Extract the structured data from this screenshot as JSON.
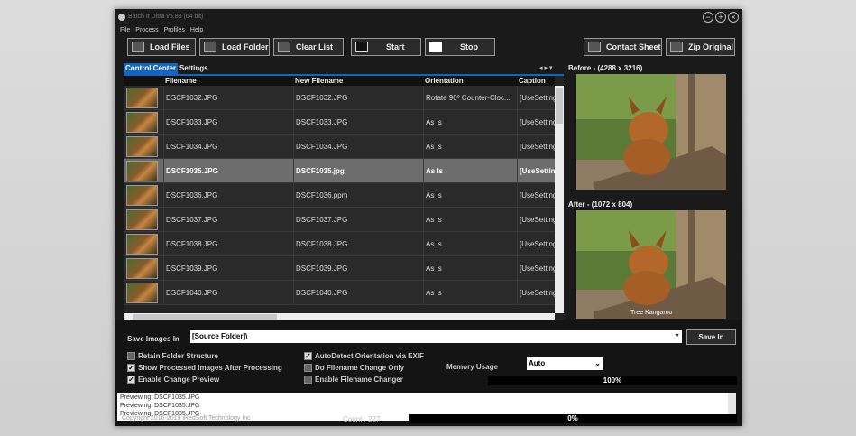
{
  "window": {
    "title": "Batch It Ultra v5.83 (64 bit)"
  },
  "menu": [
    "File",
    "Process",
    "Profiles",
    "Help"
  ],
  "toolbar": {
    "load_files": "Load Files",
    "load_folder": "Load Folder",
    "clear_list": "Clear List",
    "start": "Start",
    "stop": "Stop",
    "contact_sheet": "Contact Sheet",
    "zip_original": "Zip Original"
  },
  "tabs": [
    "Control Center",
    "Settings"
  ],
  "grid": {
    "columns": [
      "Filename",
      "New Filename",
      "Orientation",
      "Caption"
    ],
    "rows": [
      {
        "filename": "DSCF1032.JPG",
        "new_filename": "DSCF1032.JPG",
        "orientation": "Rotate 90º Counter-Cloc...",
        "caption": "[UseSetting"
      },
      {
        "filename": "DSCF1033.JPG",
        "new_filename": "DSCF1033.JPG",
        "orientation": "As Is",
        "caption": "[UseSetting"
      },
      {
        "filename": "DSCF1034.JPG",
        "new_filename": "DSCF1034.JPG",
        "orientation": "As Is",
        "caption": "[UseSetting"
      },
      {
        "filename": "DSCF1035.JPG",
        "new_filename": "DSCF1035.jpg",
        "orientation": "As Is",
        "caption": "[UseSetting",
        "selected": true
      },
      {
        "filename": "DSCF1036.JPG",
        "new_filename": "DSCF1036.ppm",
        "orientation": "As Is",
        "caption": "[UseSetting"
      },
      {
        "filename": "DSCF1037.JPG",
        "new_filename": "DSCF1037.JPG",
        "orientation": "As Is",
        "caption": "[UseSetting"
      },
      {
        "filename": "DSCF1038.JPG",
        "new_filename": "DSCF1038.JPG",
        "orientation": "As Is",
        "caption": "[UseSetting"
      },
      {
        "filename": "DSCF1039.JPG",
        "new_filename": "DSCF1039.JPG",
        "orientation": "As Is",
        "caption": "[UseSetting"
      },
      {
        "filename": "DSCF1040.JPG",
        "new_filename": "DSCF1040.JPG",
        "orientation": "As Is",
        "caption": "[UseSetting"
      }
    ]
  },
  "preview": {
    "before_label": "Before - (4288 x 3216)",
    "after_label": "After - (1072 x 804)",
    "after_caption": "Tree Kangaroo"
  },
  "save": {
    "label": "Save Images In",
    "value": "[Source Folder]\\",
    "button": "Save In"
  },
  "options": {
    "retain_folder": {
      "label": "Retain Folder Structure",
      "checked": false
    },
    "show_processed": {
      "label": "Show Processed Images After Processing",
      "checked": true
    },
    "enable_preview": {
      "label": "Enable Change Preview",
      "checked": true
    },
    "autodetect": {
      "label": "AutoDetect Orientation via EXIF",
      "checked": true
    },
    "filename_only": {
      "label": "Do Filename Change Only",
      "checked": false
    },
    "filename_changer": {
      "label": "Enable Filename Changer",
      "checked": false
    }
  },
  "memory": {
    "label": "Memory Usage",
    "value": "Auto",
    "progress_text": "100%"
  },
  "log": [
    "Previewing: DSCF1035.JPG",
    "Previewing: DSCF1035.JPG",
    "Previewing: DSCF1035.JPG"
  ],
  "status": {
    "copyright": "Copyright 2016-2019 iRedSoft Technology Inc",
    "count": "Count : 227",
    "progress_text": "0%"
  }
}
